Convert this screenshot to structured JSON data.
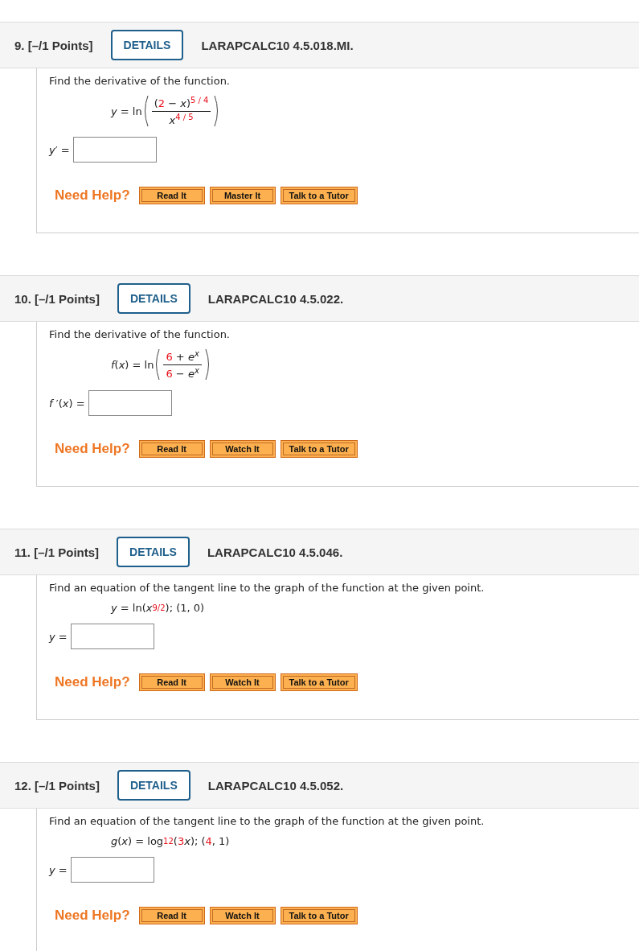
{
  "questions": [
    {
      "number": "9.",
      "points": "[–/1 Points]",
      "details_button": "DETAILS",
      "code": "LARAPCALC10 4.5.018.MI.",
      "prompt": "Find the derivative of the function.",
      "formula": {
        "lead": [
          {
            "kind": "text",
            "t": "*y* = ln"
          }
        ],
        "fraction": {
          "numerator": [
            {
              "kind": "text",
              "t": "("
            },
            {
              "kind": "value",
              "t": "2"
            },
            {
              "kind": "text",
              "t": " − *x*)"
            },
            {
              "kind": "value-sup",
              "t": "5 ∕ 4"
            }
          ],
          "denominator": [
            {
              "kind": "text",
              "t": "*x*"
            },
            {
              "kind": "value-sup",
              "t": "4 ∕ 5"
            }
          ]
        }
      },
      "answer_label": "*y*′ =",
      "help_label": "Need Help?",
      "help_buttons": [
        "Read It",
        "Master It",
        "Talk to a Tutor"
      ]
    },
    {
      "number": "10.",
      "points": "[–/1 Points]",
      "details_button": "DETAILS",
      "code": "LARAPCALC10 4.5.022.",
      "prompt": "Find the derivative of the function.",
      "formula": {
        "lead": [
          {
            "kind": "text",
            "t": "*f*(*x*) = ln"
          }
        ],
        "fraction": {
          "numerator": [
            {
              "kind": "value",
              "t": "6"
            },
            {
              "kind": "text",
              "t": " + *e*"
            },
            {
              "kind": "sup",
              "t": "*x*"
            }
          ],
          "denominator": [
            {
              "kind": "value",
              "t": "6"
            },
            {
              "kind": "text",
              "t": " − *e*"
            },
            {
              "kind": "sup",
              "t": "*x*"
            }
          ]
        }
      },
      "answer_label": "*f* ′(*x*) =",
      "help_label": "Need Help?",
      "help_buttons": [
        "Read It",
        "Watch It",
        "Talk to a Tutor"
      ]
    },
    {
      "number": "11.",
      "points": "[–/1 Points]",
      "details_button": "DETAILS",
      "code": "LARAPCALC10 4.5.046.",
      "prompt": "Find an equation of the tangent line to the graph of the function at the given point.",
      "formula": {
        "lead": [
          {
            "kind": "text",
            "t": "*y* = ln(*x*"
          },
          {
            "kind": "value-sup",
            "t": "9/2"
          },
          {
            "kind": "text",
            "t": "); (1, 0)"
          }
        ]
      },
      "answer_label": "*y* =",
      "help_label": "Need Help?",
      "help_buttons": [
        "Read It",
        "Watch It",
        "Talk to a Tutor"
      ]
    },
    {
      "number": "12.",
      "points": "[–/1 Points]",
      "details_button": "DETAILS",
      "code": "LARAPCALC10 4.5.052.",
      "prompt": "Find an equation of the tangent line to the graph of the function at the given point.",
      "formula": {
        "lead": [
          {
            "kind": "text",
            "t": "*g*(*x*) = log"
          },
          {
            "kind": "value-sub",
            "t": "12"
          },
          {
            "kind": "text",
            "t": "("
          },
          {
            "kind": "value",
            "t": "3"
          },
          {
            "kind": "text",
            "t": "*x*); ("
          },
          {
            "kind": "value",
            "t": "4"
          },
          {
            "kind": "text",
            "t": ", 1)"
          }
        ]
      },
      "answer_label": "*y* =",
      "help_label": "Need Help?",
      "help_buttons": [
        "Read It",
        "Watch It",
        "Talk to a Tutor"
      ]
    }
  ]
}
